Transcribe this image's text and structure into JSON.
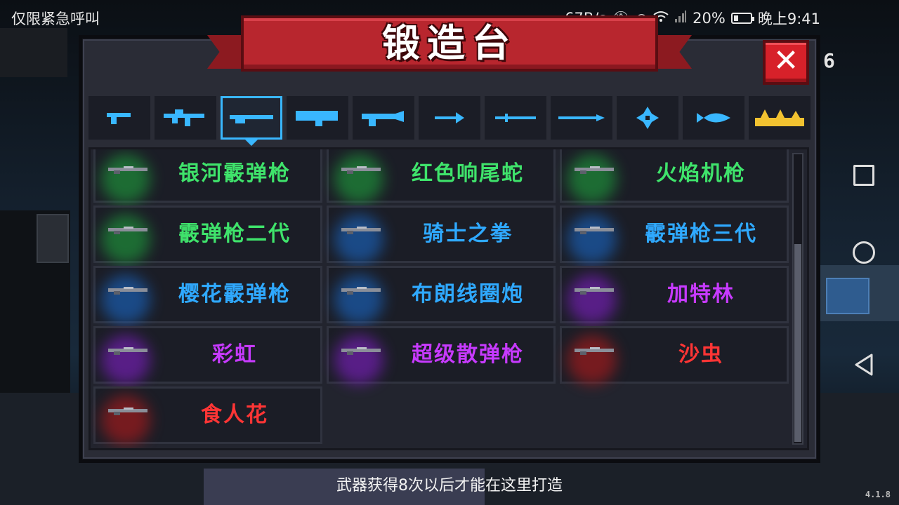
{
  "status_bar": {
    "left_text": "仅限紧急呼叫",
    "speed": "67B/s",
    "battery": "20%",
    "time": "晚上9:41",
    "icons": [
      "mute-icon",
      "eye-icon",
      "wifi-icon",
      "signal-icon",
      "battery-charging-icon"
    ]
  },
  "forge": {
    "title": "锻造台",
    "close_label": "✕",
    "side_digit": "6",
    "categories": [
      {
        "icon": "pistol-icon"
      },
      {
        "icon": "assault-rifle-icon"
      },
      {
        "icon": "shotgun-icon",
        "selected": true
      },
      {
        "icon": "launcher-icon"
      },
      {
        "icon": "special-gun-icon"
      },
      {
        "icon": "bow-icon"
      },
      {
        "icon": "sword-icon"
      },
      {
        "icon": "spear-icon"
      },
      {
        "icon": "shuriken-icon"
      },
      {
        "icon": "fish-icon"
      },
      {
        "icon": "gold-misc-icon"
      }
    ],
    "weapons": [
      {
        "name": "银河霰弹枪",
        "color": "#3fe36b",
        "glow": "#1fae3f"
      },
      {
        "name": "红色响尾蛇",
        "color": "#3fe36b",
        "glow": "#1fae3f"
      },
      {
        "name": "火焰机枪",
        "color": "#3fe36b",
        "glow": "#1fae3f"
      },
      {
        "name": "霰弹枪二代",
        "color": "#3fe36b",
        "glow": "#1fae3f"
      },
      {
        "name": "骑士之拳",
        "color": "#2fa9ff",
        "glow": "#1a6fd6"
      },
      {
        "name": "霰弹枪三代",
        "color": "#2fa9ff",
        "glow": "#1a6fd6"
      },
      {
        "name": "樱花霰弹枪",
        "color": "#2fa9ff",
        "glow": "#1a6fd6"
      },
      {
        "name": "布朗线圈炮",
        "color": "#2fa9ff",
        "glow": "#1a6fd6"
      },
      {
        "name": "加特林",
        "color": "#c73aff",
        "glow": "#8a1fd6"
      },
      {
        "name": "彩虹",
        "color": "#c73aff",
        "glow": "#8a1fd6"
      },
      {
        "name": "超级散弹枪",
        "color": "#c73aff",
        "glow": "#8a1fd6"
      },
      {
        "name": "沙虫",
        "color": "#ff3535",
        "glow": "#c21a1a"
      },
      {
        "name": "食人花",
        "color": "#ff3535",
        "glow": "#c21a1a"
      }
    ],
    "hint": "武器获得8次以后才能在这里打造"
  },
  "version": "4.1.8",
  "nav": {
    "icons": [
      "recent-apps-icon",
      "home-icon",
      "back-icon"
    ]
  },
  "colors": {
    "accent_blue": "#39b7ff",
    "banner_red": "#b8262e",
    "panel": "#2a2c36"
  }
}
